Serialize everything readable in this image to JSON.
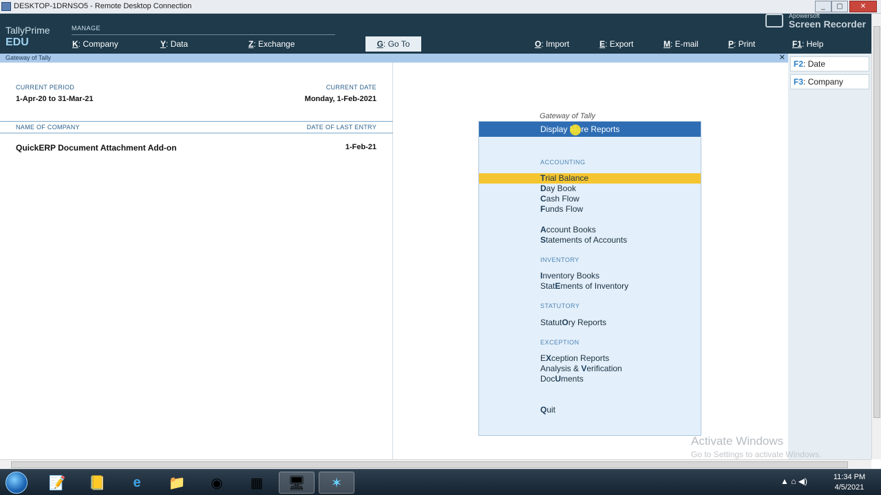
{
  "window": {
    "title": "DESKTOP-1DRNSO5 - Remote Desktop Connection",
    "controls": [
      "_",
      "▢",
      "✕"
    ]
  },
  "brand": {
    "product": "TallyPrime",
    "edition": "EDU"
  },
  "topmenu": {
    "manage_label": "MANAGE",
    "company": {
      "key": "K",
      "label": "Company"
    },
    "data": {
      "key": "Y",
      "label": "Data"
    },
    "exchange": {
      "key": "Z",
      "label": "Exchange"
    },
    "goto": {
      "key": "G",
      "label": "Go To"
    },
    "import": {
      "key": "O",
      "label": "Import"
    },
    "export": {
      "key": "E",
      "label": "Export"
    },
    "email": {
      "key": "M",
      "label": "E-mail"
    },
    "print": {
      "key": "P",
      "label": "Print"
    },
    "help": {
      "key": "F1",
      "label": "Help"
    }
  },
  "recorder": {
    "small": "Apowersoft",
    "big": "Screen Recorder"
  },
  "gateway_bar": {
    "title": "Gateway of Tally",
    "close": "✕"
  },
  "left": {
    "current_period_label": "CURRENT PERIOD",
    "current_period": "1-Apr-20 to 31-Mar-21",
    "current_date_label": "CURRENT DATE",
    "current_date": "Monday, 1-Feb-2021",
    "name_of_company_label": "NAME OF COMPANY",
    "date_last_entry_label": "DATE OF LAST ENTRY",
    "company_name": "QuickERP Document Attachment Add-on",
    "last_entry": "1-Feb-21"
  },
  "gateway": {
    "title": "Gateway of Tally",
    "selected": "Display More Reports",
    "accounting_label": "ACCOUNTING",
    "inventory_label": "INVENTORY",
    "statutory_label": "STATUTORY",
    "exception_label": "EXCEPTION",
    "items": {
      "trial_balance": {
        "k": "T",
        "rest": "rial Balance"
      },
      "day_book": {
        "k": "D",
        "rest": "ay Book"
      },
      "cash_flow": {
        "k": "C",
        "rest": "ash Flow"
      },
      "funds_flow": {
        "k": "F",
        "rest": "unds Flow"
      },
      "account_books": {
        "k": "A",
        "rest": "ccount Books"
      },
      "statements_accounts": {
        "k": "S",
        "rest": "tatements of Accounts"
      },
      "inventory_books": {
        "k": "I",
        "rest": "nventory Books"
      },
      "statements_inventory": {
        "pre": "Stat",
        "k": "E",
        "rest": "ments of Inventory"
      },
      "statutory_reports": {
        "pre": "Statut",
        "k": "O",
        "rest": "ry Reports"
      },
      "exception_reports": {
        "pre": "E",
        "k": "X",
        "rest": "ception Reports"
      },
      "analysis_verification": {
        "pre": "Analysis & ",
        "k": "V",
        "rest": "erification"
      },
      "documents": {
        "pre": "Doc",
        "k": "U",
        "rest": "ments"
      },
      "quit": {
        "k": "Q",
        "rest": "uit"
      }
    }
  },
  "fpanel": {
    "date": {
      "key": "F2",
      "label": "Date"
    },
    "company": {
      "key": "F3",
      "label": "Company"
    }
  },
  "watermark": {
    "line1": "Activate Windows",
    "line2": "Go to Settings to activate Windows."
  },
  "taskbar": {
    "icons": [
      "windows-start",
      "notepad",
      "tally-erp9",
      "internet-explorer",
      "file-explorer",
      "chrome",
      "app-blue-yellow",
      "remote-desktop",
      "tally-prime-star"
    ],
    "tray": "▲ ⌂ ◀)",
    "time": "11:34 PM",
    "date": "4/5/2021"
  }
}
